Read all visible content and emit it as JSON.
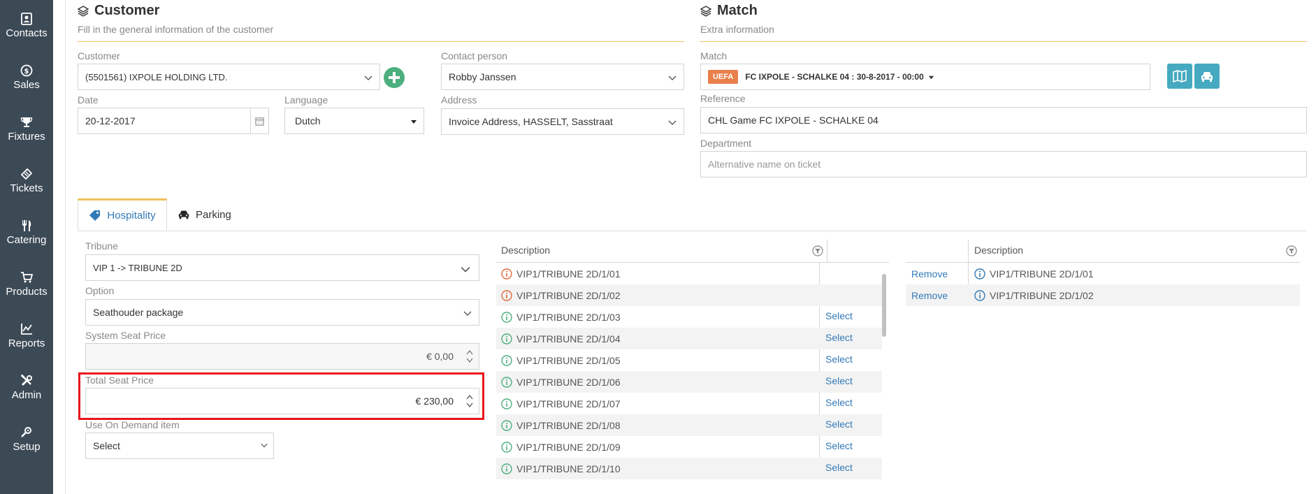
{
  "sidebar": {
    "items": [
      {
        "label": "Contacts",
        "icon": "contacts-icon"
      },
      {
        "label": "Sales",
        "icon": "dollar-icon"
      },
      {
        "label": "Fixtures",
        "icon": "trophy-icon"
      },
      {
        "label": "Tickets",
        "icon": "ticket-icon"
      },
      {
        "label": "Catering",
        "icon": "cutlery-icon"
      },
      {
        "label": "Products",
        "icon": "cart-icon"
      },
      {
        "label": "Reports",
        "icon": "chart-icon"
      },
      {
        "label": "Admin",
        "icon": "tools-icon"
      },
      {
        "label": "Setup",
        "icon": "setup-icon"
      }
    ]
  },
  "customer_section": {
    "title": "Customer",
    "subtitle": "Fill in the general information of the customer",
    "customer_label": "Customer",
    "customer_value": "(5501561) IXPOLE HOLDING LTD.",
    "contact_label": "Contact person",
    "contact_value": "Robby Janssen",
    "date_label": "Date",
    "date_value": "20-12-2017",
    "language_label": "Language",
    "language_value": "Dutch",
    "address_label": "Address",
    "address_value": "Invoice Address, HASSELT, Sasstraat"
  },
  "match_section": {
    "title": "Match",
    "subtitle": "Extra information",
    "match_label": "Match",
    "match_badge": "UEFA",
    "match_value": "FC IXPOLE - SCHALKE 04 : 30-8-2017 - 00:00",
    "reference_label": "Reference",
    "reference_value": "CHL Game FC IXPOLE - SCHALKE 04",
    "department_label": "Department",
    "department_placeholder": "Alternative name on ticket"
  },
  "tabs": [
    {
      "label": "Hospitality",
      "active": true
    },
    {
      "label": "Parking",
      "active": false
    }
  ],
  "hospitality": {
    "tribune_label": "Tribune",
    "tribune_value": "VIP 1 -> TRIBUNE 2D",
    "option_label": "Option",
    "option_value": "Seathouder package",
    "system_price_label": "System Seat Price",
    "system_price_value": "€ 0,00",
    "total_price_label": "Total Seat Price",
    "total_price_value": "€ 230,00",
    "on_demand_label": "Use On Demand item",
    "on_demand_value": "Select"
  },
  "available_table": {
    "header": "Description",
    "select_label": "Select",
    "rows": [
      {
        "desc": "VIP1/TRIBUNE 2D/1/01",
        "status": "taken"
      },
      {
        "desc": "VIP1/TRIBUNE 2D/1/02",
        "status": "taken"
      },
      {
        "desc": "VIP1/TRIBUNE 2D/1/03",
        "status": "free"
      },
      {
        "desc": "VIP1/TRIBUNE 2D/1/04",
        "status": "free"
      },
      {
        "desc": "VIP1/TRIBUNE 2D/1/05",
        "status": "free"
      },
      {
        "desc": "VIP1/TRIBUNE 2D/1/06",
        "status": "free"
      },
      {
        "desc": "VIP1/TRIBUNE 2D/1/07",
        "status": "free"
      },
      {
        "desc": "VIP1/TRIBUNE 2D/1/08",
        "status": "free"
      },
      {
        "desc": "VIP1/TRIBUNE 2D/1/09",
        "status": "free"
      },
      {
        "desc": "VIP1/TRIBUNE 2D/1/10",
        "status": "free"
      }
    ]
  },
  "selected_table": {
    "header": "Description",
    "remove_label": "Remove",
    "rows": [
      {
        "desc": "VIP1/TRIBUNE 2D/1/01"
      },
      {
        "desc": "VIP1/TRIBUNE 2D/1/02"
      }
    ]
  },
  "colors": {
    "sidebar": "#3c4a56",
    "accent_rule": "#f0c05a",
    "teal": "#45a9c0",
    "green_add": "#4caf7d",
    "highlight": "#e8141b",
    "link": "#337ab7",
    "badge": "#e8804c"
  }
}
